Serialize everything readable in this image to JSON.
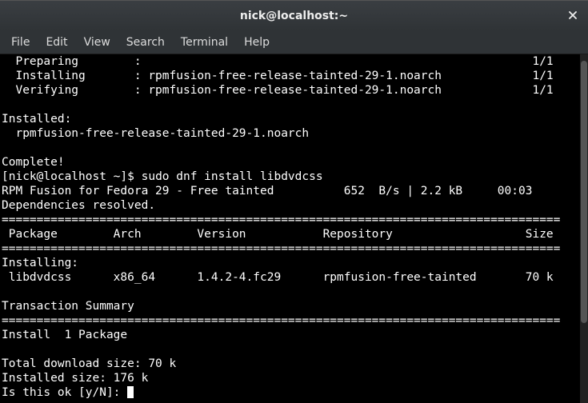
{
  "window": {
    "title": "nick@localhost:~"
  },
  "menubar": {
    "items": [
      {
        "label": "File"
      },
      {
        "label": "Edit"
      },
      {
        "label": "View"
      },
      {
        "label": "Search"
      },
      {
        "label": "Terminal"
      },
      {
        "label": "Help"
      }
    ]
  },
  "terminal": {
    "lines": {
      "l0": "  Preparing        :                                                        1/1",
      "l1": "  Installing       : rpmfusion-free-release-tainted-29-1.noarch             1/1",
      "l2": "  Verifying        : rpmfusion-free-release-tainted-29-1.noarch             1/1",
      "l3": "",
      "l4": "Installed:",
      "l5": "  rpmfusion-free-release-tainted-29-1.noarch",
      "l6": "",
      "l7": "Complete!",
      "prompt_prefix": "[nick@localhost ~]$ ",
      "prompt_cmd": "sudo dnf install libdvdcss",
      "l9": "RPM Fusion for Fedora 29 - Free tainted          652  B/s | 2.2 kB     00:03",
      "l10": "Dependencies resolved.",
      "l11": "================================================================================",
      "l12": " Package        Arch        Version           Repository                   Size",
      "l13": "================================================================================",
      "l14": "Installing:",
      "l15": " libdvdcss      x86_64      1.4.2-4.fc29      rpmfusion-free-tainted       70 k",
      "l16": "",
      "l17": "Transaction Summary",
      "l18": "================================================================================",
      "l19": "Install  1 Package",
      "l20": "",
      "l21": "Total download size: 70 k",
      "l22": "Installed size: 176 k",
      "l23": "Is this ok [y/N]: "
    }
  }
}
